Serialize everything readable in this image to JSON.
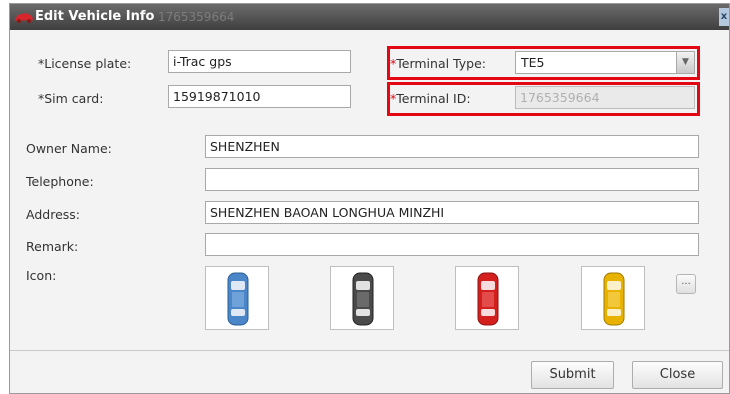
{
  "dialog": {
    "title": "Edit Vehicle Info",
    "title_ghost": "1765359664",
    "close_label": "x"
  },
  "form": {
    "license_plate": {
      "label": "*License plate:",
      "value": "i-Trac gps"
    },
    "sim_card": {
      "label": "*Sim card:",
      "value": "15919871010"
    },
    "terminal_type": {
      "label_star": "*",
      "label": "Terminal Type:",
      "value": "TE5"
    },
    "terminal_id": {
      "label_star": "*",
      "label": "Terminal ID:",
      "value": "1765359664"
    },
    "owner_name": {
      "label": "Owner Name:",
      "value": "SHENZHEN"
    },
    "telephone": {
      "label": "Telephone:",
      "value": ""
    },
    "address": {
      "label": "Address:",
      "value": "SHENZHEN BAOAN LONGHUA MINZHI"
    },
    "remark": {
      "label": "Remark:",
      "value": ""
    },
    "icon": {
      "label": "Icon:",
      "options": [
        {
          "name": "car-blue-icon",
          "color": "#4a86c8"
        },
        {
          "name": "car-black-icon",
          "color": "#4a4a4a"
        },
        {
          "name": "car-red-icon",
          "color": "#d41f1f"
        },
        {
          "name": "car-yellow-icon",
          "color": "#e8b300"
        }
      ],
      "more_label": "..."
    }
  },
  "buttons": {
    "submit": "Submit",
    "close": "Close"
  },
  "colors": {
    "highlight": "#e30613",
    "titlebar": "#4d4d4d"
  }
}
